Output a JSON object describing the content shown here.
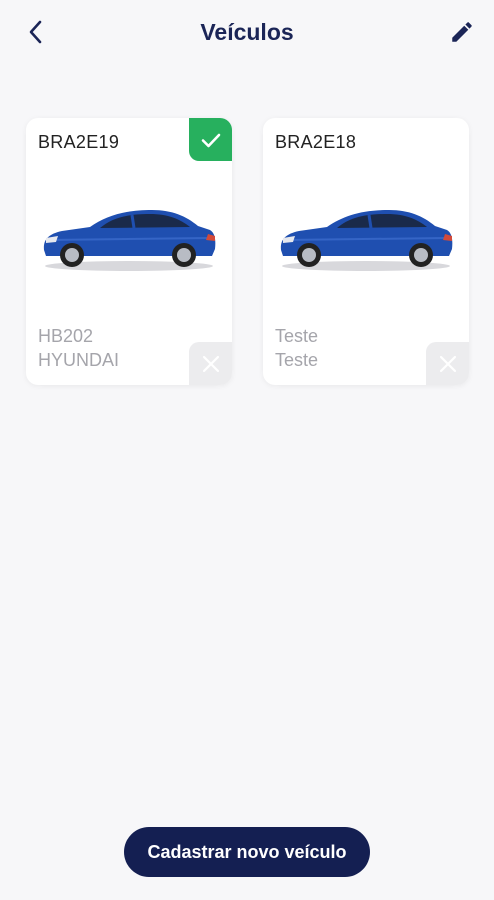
{
  "header": {
    "title": "Veículos",
    "back_icon": "chevron-left-icon",
    "edit_icon": "pencil-icon"
  },
  "vehicles": [
    {
      "plate": "BRA2E19",
      "model": "HB202",
      "brand": "HYUNDAI",
      "selected": true
    },
    {
      "plate": "BRA2E18",
      "model": "Teste",
      "brand": "Teste",
      "selected": false
    }
  ],
  "actions": {
    "register_label": "Cadastrar novo veículo"
  },
  "colors": {
    "primary": "#141f52",
    "title": "#1b2557",
    "selected": "#27b05e",
    "car_body": "#1f4fb0"
  }
}
